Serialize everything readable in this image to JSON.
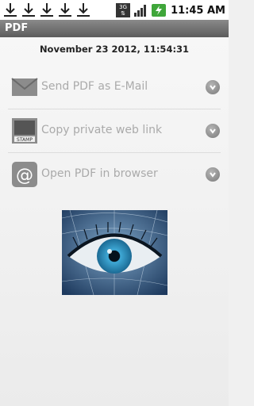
{
  "status_bar": {
    "network": "3G",
    "time": "11:45 AM",
    "icons": [
      "download-icon",
      "download-icon",
      "download-icon",
      "download-icon",
      "download-icon",
      "3g-icon",
      "signal-icon",
      "battery-icon"
    ]
  },
  "title_bar": {
    "title": "PDF"
  },
  "main": {
    "datetime": "November 23 2012, 11:54:31",
    "actions": [
      {
        "label": "Send PDF as E-Mail",
        "icon": "envelope-icon"
      },
      {
        "label": "Copy private web link",
        "icon": "stamp-icon",
        "icon_text": "STAMP"
      },
      {
        "label": "Open PDF in browser",
        "icon": "at-sign-icon",
        "icon_text": "@"
      }
    ]
  },
  "colors": {
    "title_bar": "#6e6e6e",
    "label": "#aaaaaa",
    "background": "#f0f0f0"
  }
}
